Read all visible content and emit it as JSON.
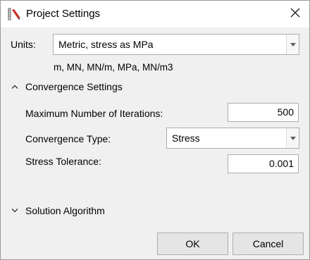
{
  "window": {
    "title": "Project Settings",
    "icons": {
      "app": "ruler-pencil-icon",
      "close": "close-icon"
    }
  },
  "units": {
    "label": "Units:",
    "selected": "Metric, stress as MPa",
    "summary": "m, MN, MN/m, MPa, MN/m3"
  },
  "convergence": {
    "header": "Convergence Settings",
    "expanded": true,
    "max_iterations_label": "Maximum Number of Iterations:",
    "max_iterations_value": "500",
    "type_label": "Convergence Type:",
    "type_selected": "Stress",
    "tolerance_label": "Stress Tolerance:",
    "tolerance_value": "0.001"
  },
  "solution": {
    "header": "Solution Algorithm",
    "expanded": false
  },
  "buttons": {
    "ok": "OK",
    "cancel": "Cancel"
  }
}
